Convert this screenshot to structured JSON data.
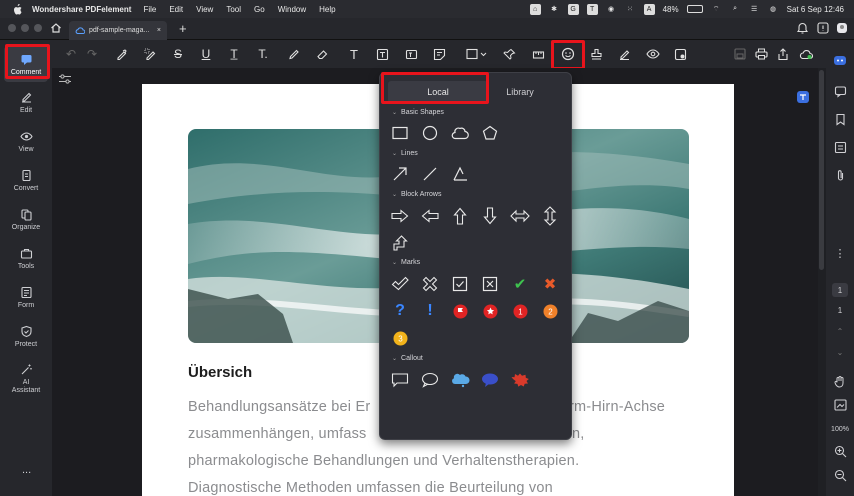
{
  "menubar": {
    "app_name": "Wondershare PDFelement",
    "items": [
      "File",
      "Edit",
      "View",
      "Tool",
      "Go",
      "Window",
      "Help"
    ],
    "battery": "48%",
    "datetime": "Sat 6 Sep  12:46"
  },
  "tab": {
    "title": "pdf-sample-maga..."
  },
  "sidebar": {
    "items": [
      {
        "label": "Comment"
      },
      {
        "label": "Edit"
      },
      {
        "label": "View"
      },
      {
        "label": "Convert"
      },
      {
        "label": "Organize"
      },
      {
        "label": "Tools"
      },
      {
        "label": "Form"
      },
      {
        "label": "Protect"
      },
      {
        "label": "AI Assistant"
      }
    ],
    "more": "..."
  },
  "popup": {
    "tabs": {
      "local": "Local",
      "library": "Library"
    },
    "sections": {
      "basic": "Basic Shapes",
      "lines": "Lines",
      "arrows": "Block Arrows",
      "marks": "Marks",
      "callout": "Callout"
    },
    "mark_numbers": [
      "1",
      "2",
      "3"
    ],
    "glyphs": {
      "question": "?",
      "exclaim": "!",
      "check": "✔",
      "cross": "✖"
    }
  },
  "document": {
    "heading": "Übersich",
    "lines": [
      "Behandlungsansätze bei Er",
      "zusammenhängen, umfass",
      "pharmakologische Behandlungen und Verhaltenstherapien.",
      "Diagnostische Methoden umfassen die Beurteilung von"
    ],
    "line1_tail": "rm-Hirn-Achse",
    "line2_tail": "n,"
  },
  "rightbar": {
    "page_current": "1",
    "page_total": "1",
    "zoom": "100%",
    "more": "⋮"
  },
  "colors": {
    "accent_red": "#e8141c",
    "check_green": "#3ec24f",
    "cross_orange": "#e85a2a",
    "question_blue": "#3a86ff"
  }
}
